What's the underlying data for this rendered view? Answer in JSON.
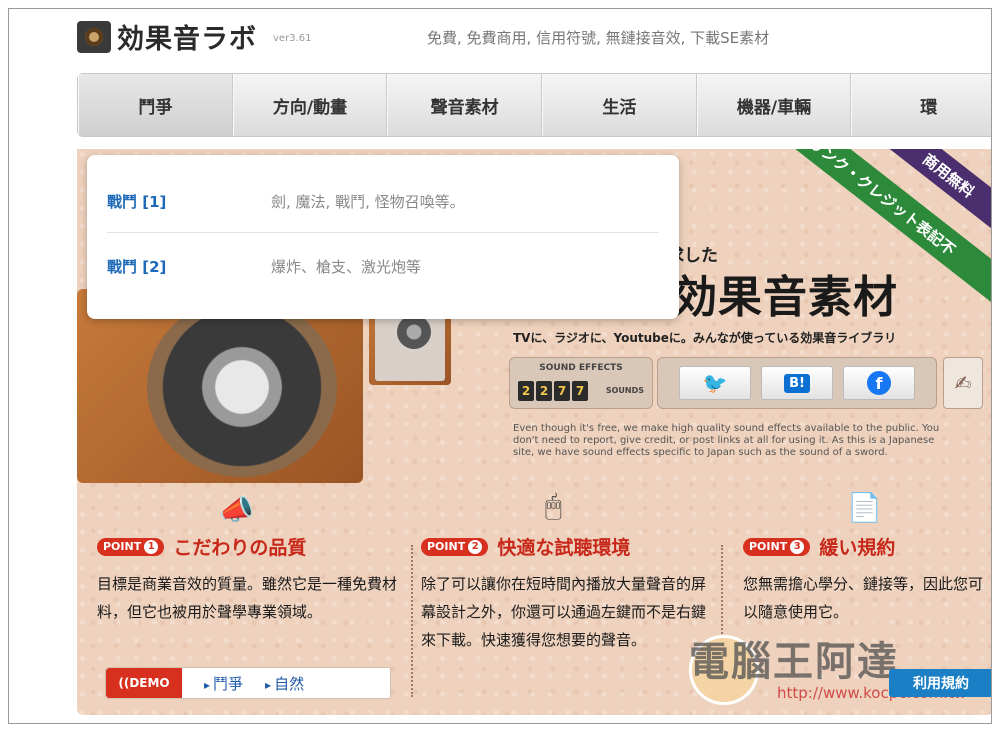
{
  "header": {
    "logo_text": "効果音ラボ",
    "version": "ver3.61",
    "tagline": "免費, 免費商用, 信用符號, 無鏈接音效, 下載SE素材"
  },
  "nav": {
    "items": [
      {
        "label": "鬥爭"
      },
      {
        "label": "方向/動畫"
      },
      {
        "label": "聲音素材"
      },
      {
        "label": "生活"
      },
      {
        "label": "機器/車輛"
      },
      {
        "label": "環"
      }
    ],
    "active": "鬥爭"
  },
  "dropdown": {
    "items": [
      {
        "label": "戰鬥 [1]",
        "desc": "劍, 魔法, 戰鬥, 怪物召喚等。"
      },
      {
        "label": "戰鬥 [2]",
        "desc": "爆炸、槍支、激光炮等"
      }
    ]
  },
  "hero": {
    "small_text": "求した",
    "title": "効果音素材",
    "subtitle": "TVに、ラジオに、Youtubeに。みんなが使っている効果音ライブラリ",
    "ribbon_green": "リンク・クレジット表記不",
    "ribbon_purple": "商用無料",
    "counter_label": "SOUND EFFECTS",
    "counter_digits": [
      "2",
      "2",
      "7",
      "7"
    ],
    "counter_suffix": "SOUNDS",
    "share": {
      "twitter": "🐦",
      "hatena": "B!",
      "facebook": "f"
    },
    "english_text": "Even though it's free, we make high quality sound effects available to the public. You don't need to report, give credit, or post links at all for using it. As this is a Japanese site, we have sound effects specific to Japan such as the sound of a sword."
  },
  "points": [
    {
      "badge": "POINT",
      "num": "1",
      "title": "こだわりの品質",
      "body": "目標是商業音效的質量。雖然它是一種免費材料，但它也被用於聲學專業領域。"
    },
    {
      "badge": "POINT",
      "num": "2",
      "title": "快適な試聴環境",
      "body": "除了可以讓你在短時間內播放大量聲音的屏幕設計之外，你還可以通過左鍵而不是右鍵來下載。快速獲得您想要的聲音。"
    },
    {
      "badge": "POINT",
      "num": "3",
      "title": "緩い規約",
      "body": "您無需擔心學分、鏈接等，因此您可以隨意使用它。"
    }
  ],
  "demo": {
    "label": "((DEMO",
    "links": [
      "鬥爭",
      "自然"
    ]
  },
  "terms_button": "利用規約",
  "watermark": {
    "text": "電腦王阿達",
    "url": "http://www.kocpc.com.tw"
  }
}
